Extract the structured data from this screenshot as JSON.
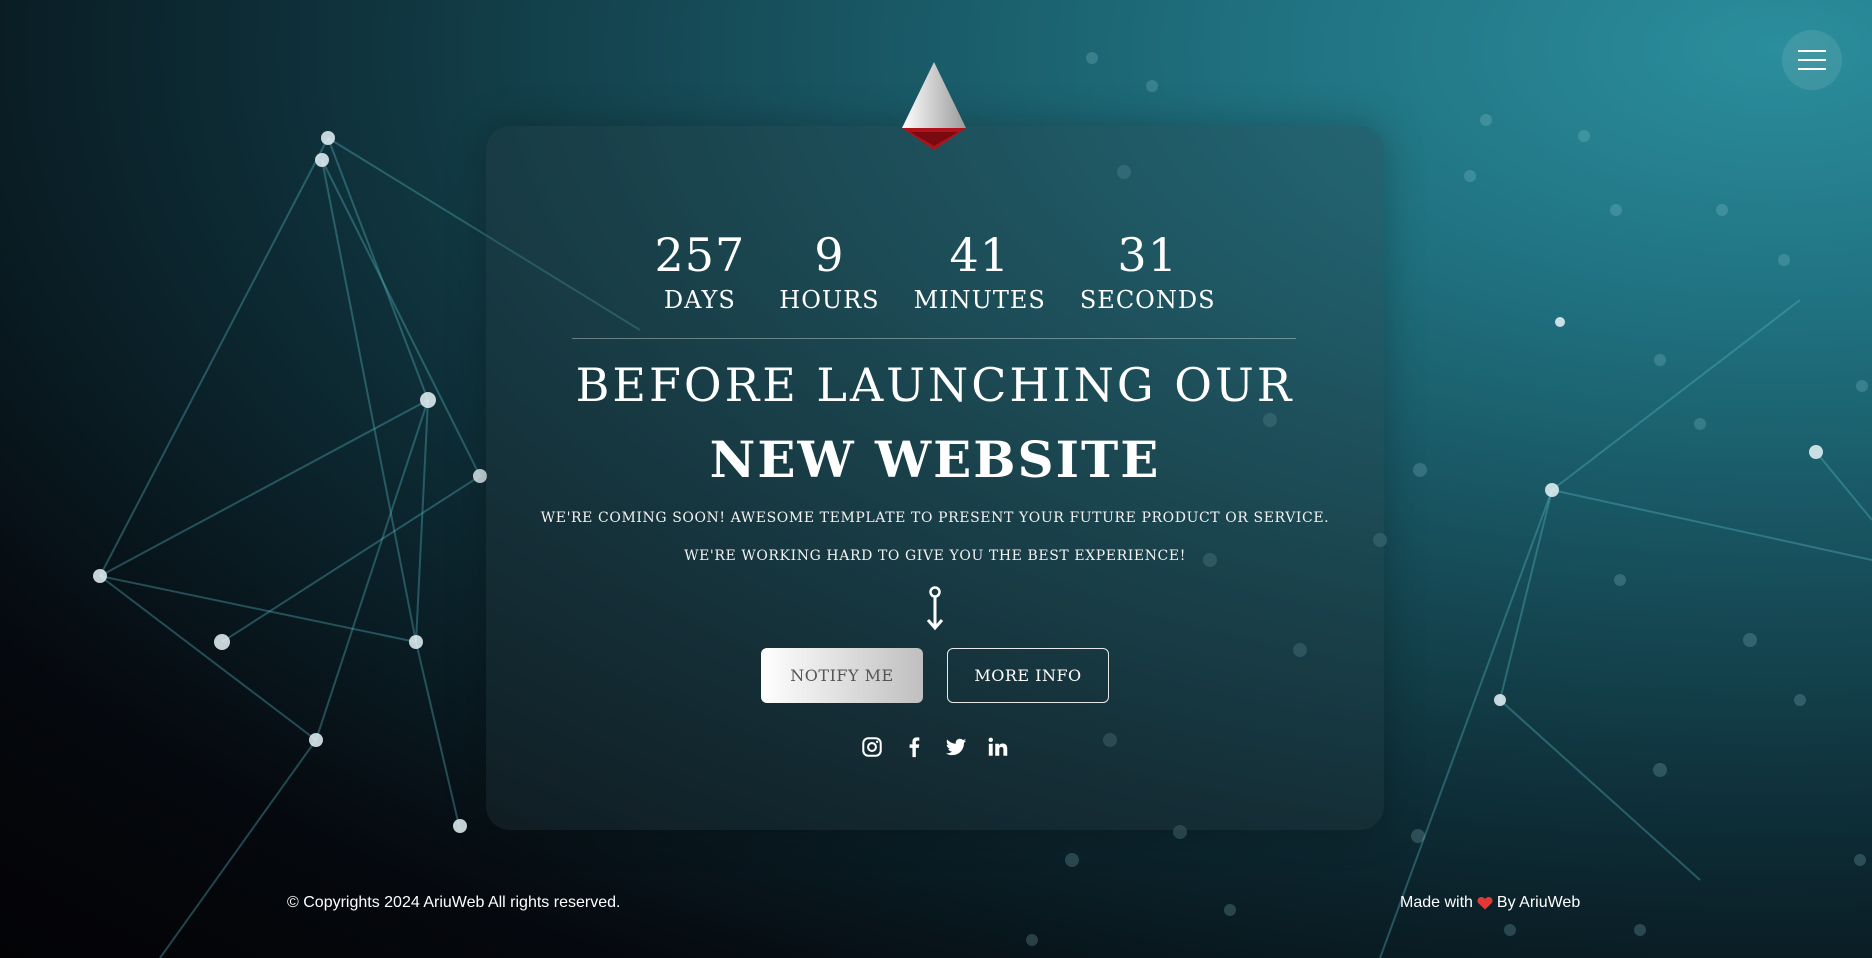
{
  "countdown": [
    {
      "value": "257",
      "label": "DAYS"
    },
    {
      "value": "9",
      "label": "HOURS"
    },
    {
      "value": "41",
      "label": "MINUTES"
    },
    {
      "value": "31",
      "label": "SECONDS"
    }
  ],
  "headline": {
    "line1": "BEFORE LAUNCHING OUR",
    "line2": "NEW WEBSITE"
  },
  "subtext": {
    "line1": "WE'RE COMING SOON! AWESOME TEMPLATE TO PRESENT YOUR FUTURE PRODUCT OR SERVICE.",
    "line2": "WE'RE WORKING HARD TO GIVE YOU THE BEST EXPERIENCE!"
  },
  "buttons": {
    "notify": "NOTIFY ME",
    "more_info": "MORE INFO"
  },
  "social_icons": [
    "instagram-icon",
    "facebook-icon",
    "twitter-icon",
    "linkedin-icon"
  ],
  "footer": {
    "copyright": "© Copyrights 2024 AriuWeb All rights reserved.",
    "made_with": "Made with",
    "by": "By AriuWeb"
  },
  "colors": {
    "accent_teal": "#2b8e9c",
    "heart_red": "#e53935",
    "logo_red": "#b0121b"
  }
}
